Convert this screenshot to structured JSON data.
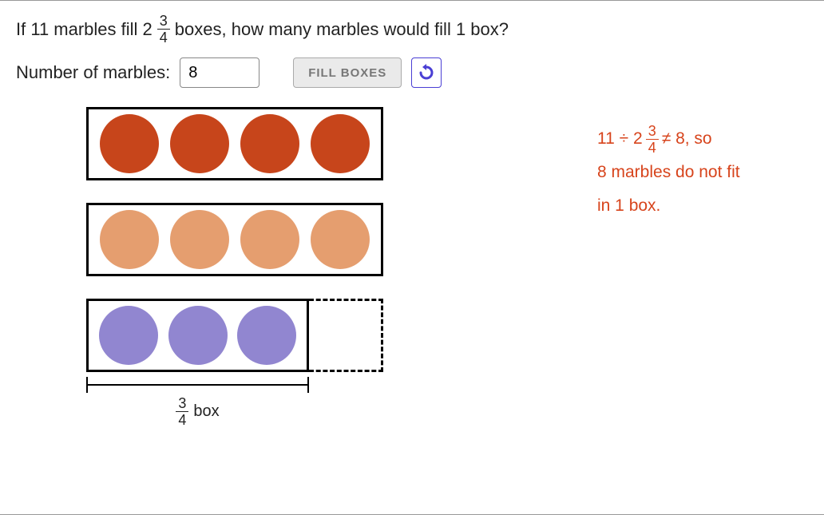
{
  "question": {
    "seg1": "If 11 marbles fill 2",
    "frac_num": "3",
    "frac_den": "4",
    "seg2": " boxes, how many marbles would fill 1 box?"
  },
  "controls": {
    "label": "Number of marbles:",
    "input_value": "8",
    "fill_label": "FILL BOXES"
  },
  "boxes": {
    "box1_marbles": 4,
    "box2_marbles": 4,
    "box3_marbles": 3,
    "box3_fraction_label_num": "3",
    "box3_fraction_label_den": "4",
    "box3_fraction_word": "box"
  },
  "feedback": {
    "pre": "11 ÷ 2",
    "frac_num": "3",
    "frac_den": "4",
    "post1": "≠ 8, so",
    "line2": "8 marbles do not fit",
    "line3": "in 1 box."
  }
}
